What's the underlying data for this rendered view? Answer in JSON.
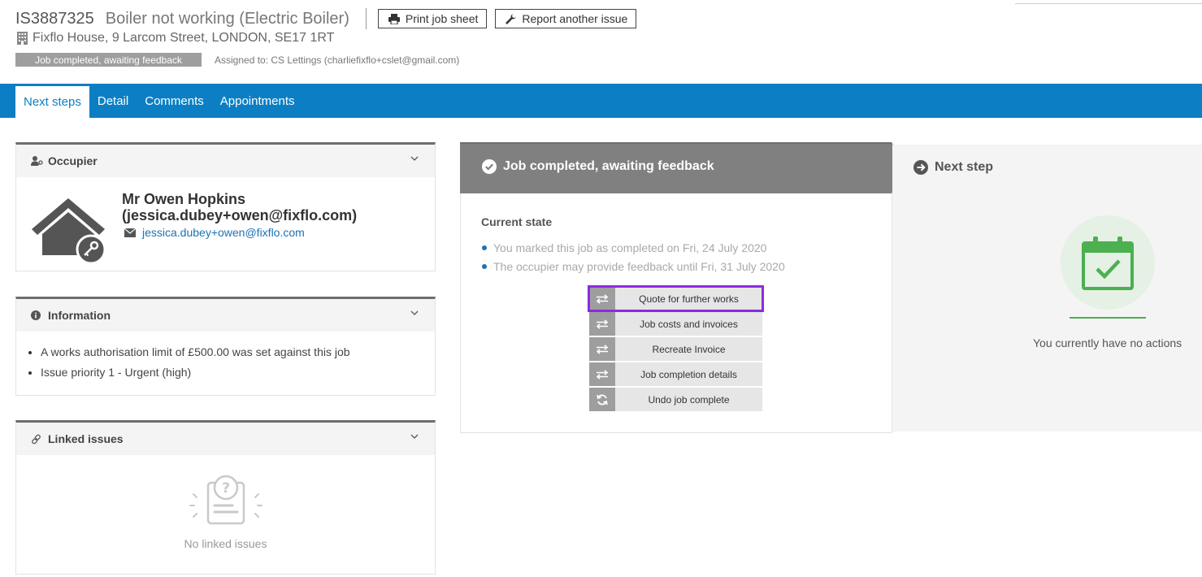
{
  "header": {
    "issue_ref": "IS3887325",
    "issue_title": "Boiler not working (Electric Boiler)",
    "print_label": "Print job sheet",
    "report_label": "Report another issue",
    "address": "Fixflo House, 9 Larcom Street, LONDON, SE17 1RT",
    "status_badge": "Job completed, awaiting feedback",
    "assigned": "Assigned to: CS Lettings (charliefixflo+cslet@gmail.com)"
  },
  "nav": {
    "tabs": [
      {
        "label": "Next steps",
        "active": true
      },
      {
        "label": "Detail",
        "active": false
      },
      {
        "label": "Comments",
        "active": false
      },
      {
        "label": "Appointments",
        "active": false
      }
    ]
  },
  "occupier": {
    "title": "Occupier",
    "name": "Mr Owen Hopkins (jessica.dubey+owen@fixflo.com)",
    "email": "jessica.dubey+owen@fixflo.com"
  },
  "information": {
    "title": "Information",
    "items": [
      "A works authorisation limit of £500.00 was set against this job",
      "Issue priority 1 - Urgent (high)"
    ]
  },
  "linked": {
    "title": "Linked issues",
    "empty_text": "No linked issues"
  },
  "state": {
    "title": "Job completed, awaiting feedback",
    "current_label": "Current state",
    "items": [
      "You marked this job as completed on Fri, 24 July 2020",
      "The occupier may provide feedback until Fri, 31 July 2020"
    ],
    "actions": [
      {
        "label": "Quote for further works",
        "icon": "swap-icon"
      },
      {
        "label": "Job costs and invoices",
        "icon": "swap-icon"
      },
      {
        "label": "Recreate Invoice",
        "icon": "swap-icon"
      },
      {
        "label": "Job completion details",
        "icon": "swap-icon"
      },
      {
        "label": "Undo job complete",
        "icon": "refresh-icon"
      }
    ]
  },
  "next_step": {
    "title": "Next step",
    "empty_text": "You currently have no actions"
  },
  "colors": {
    "nav_blue": "#0c7fc4",
    "highlight": "#8a2be2",
    "success_green": "#4caf50"
  }
}
